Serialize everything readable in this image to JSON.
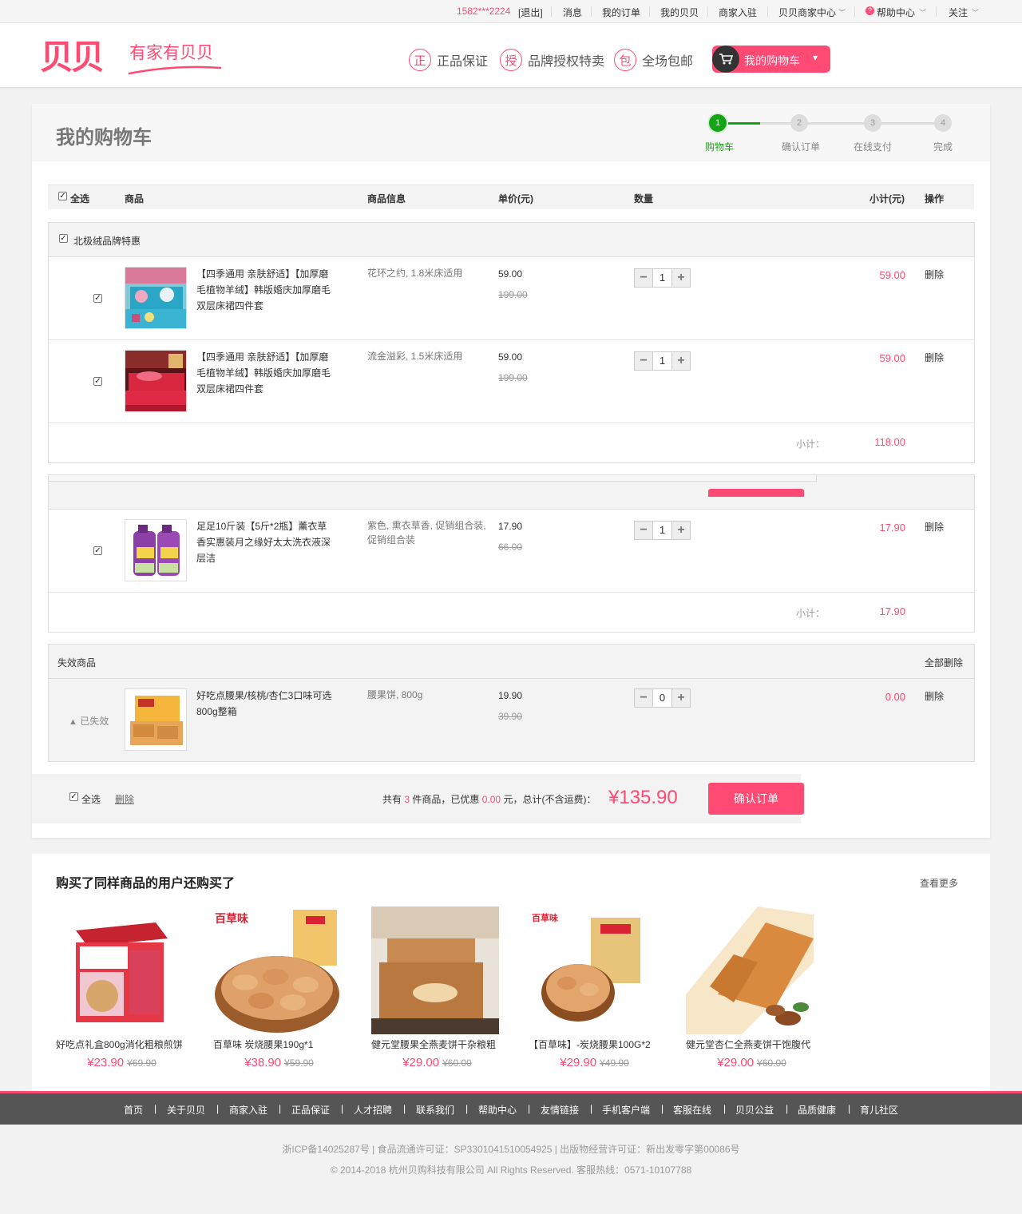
{
  "topbar": {
    "phone": "1582***2224",
    "logout": "[退出]",
    "messages": "消息",
    "my_orders": "我的订单",
    "my_beibei": "我的贝贝",
    "merchant_join": "商家入驻",
    "merchant_center": "贝贝商家中心",
    "help_center": "帮助中心",
    "follow": "关注"
  },
  "header": {
    "logo": "贝贝",
    "slogan": "有家有贝贝",
    "features": [
      {
        "icon": "正",
        "label": "正品保证"
      },
      {
        "icon": "授",
        "label": "品牌授权特卖"
      },
      {
        "icon": "包",
        "label": "全场包邮"
      }
    ],
    "cart_button": "我的购物车"
  },
  "page": {
    "title": "我的购物车",
    "steps": [
      {
        "num": "1",
        "label": "购物车"
      },
      {
        "num": "2",
        "label": "确认订单"
      },
      {
        "num": "3",
        "label": "在线支付"
      },
      {
        "num": "4",
        "label": "完成"
      }
    ]
  },
  "table_headers": {
    "select_all": "全选",
    "product": "商品",
    "info": "商品信息",
    "unit_price": "单价(元)",
    "quantity": "数量",
    "subtotal": "小计(元)",
    "action": "操作"
  },
  "shops": [
    {
      "name": "北极绒品牌特惠",
      "items": [
        {
          "name": "【四季通用 亲肤舒适】【加厚磨毛植物羊绒】韩版婚庆加厚磨毛双层床裙四件套",
          "info": "花环之约, 1.8米床适用",
          "price": "59.00",
          "orig": "199.00",
          "qty": "1",
          "subtotal": "59.00",
          "del": "删除"
        },
        {
          "name": "【四季通用 亲肤舒适】【加厚磨毛植物羊绒】韩版婚庆加厚磨毛双层床裙四件套",
          "info": "流金溢彩, 1.5米床适用",
          "price": "59.00",
          "orig": "199.00",
          "qty": "1",
          "subtotal": "59.00",
          "del": "删除"
        }
      ],
      "subtotal_label": "小计：",
      "subtotal": "118.00"
    },
    {
      "name": "",
      "items": [
        {
          "name": "足足10斤装【5斤*2瓶】薰衣草香实惠装月之缘好太太洗衣液深层洁",
          "info": "紫色, 熏衣草香, 促销组合装, 促销组合装",
          "price": "17.90",
          "orig": "66.00",
          "qty": "1",
          "subtotal": "17.90",
          "del": "删除"
        }
      ],
      "subtotal_label": "小计：",
      "subtotal": "17.90"
    }
  ],
  "invalid": {
    "title": "失效商品",
    "delete_all": "全部删除",
    "status": "已失效",
    "item": {
      "name": "好吃点腰果/核桃/杏仁3口味可选800g整箱",
      "info": "腰果饼, 800g",
      "price": "19.90",
      "orig": "39.90",
      "qty": "0",
      "subtotal": "0.00",
      "del": "删除"
    }
  },
  "summary": {
    "select_all": "全选",
    "delete": "删除",
    "text_prefix": "共有",
    "count": "3",
    "text_mid": "件商品，已优惠",
    "discount": "0.00",
    "text_suffix": "元，总计(不含运费)：",
    "total": "¥135.90",
    "confirm": "确认订单"
  },
  "recommend": {
    "title": "购买了同样商品的用户还购买了",
    "more": "查看更多",
    "items": [
      {
        "name": "好吃点礼盒800g消化粗粮煎饼",
        "price": "¥23.90",
        "orig": "¥69.90"
      },
      {
        "name": "百草味 炭烧腰果190g*1",
        "price": "¥38.90",
        "orig": "¥59.90"
      },
      {
        "name": "健元堂腰果全燕麦饼干杂粮粗",
        "price": "¥29.00",
        "orig": "¥60.00"
      },
      {
        "name": "【百草味】-炭烧腰果100G*2",
        "price": "¥29.90",
        "orig": "¥49.90"
      },
      {
        "name": "健元堂杏仁全燕麦饼干饱腹代",
        "price": "¥29.00",
        "orig": "¥60.00"
      }
    ]
  },
  "footer": {
    "nav": [
      "首页",
      "关于贝贝",
      "商家入驻",
      "正品保证",
      "人才招聘",
      "联系我们",
      "帮助中心",
      "友情链接",
      "手机客户端",
      "客服在线",
      "贝贝公益",
      "品质健康",
      "育儿社区"
    ],
    "license": "浙ICP备14025287号 | 食品流通许可证：SP3301041510054925 | 出版物经营许可证：新出发零字第00086号",
    "copyright": "© 2014-2018 杭州贝购科技有限公司 All Rights Reserved. 客服热线：0571-10107788"
  },
  "colors": {
    "brand": "#ff4a73",
    "step_active": "#17a317",
    "footer_bg": "#555555"
  }
}
